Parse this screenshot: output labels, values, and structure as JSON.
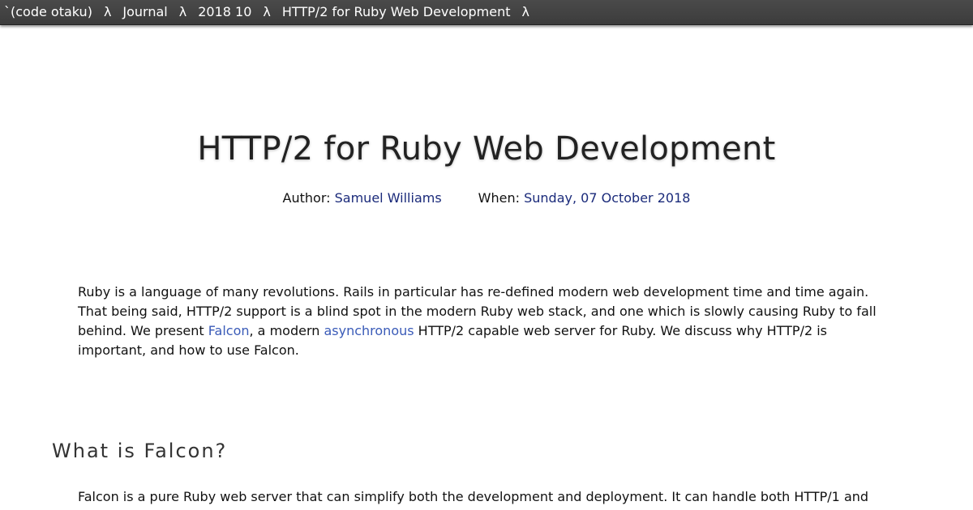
{
  "nav": {
    "breadcrumbs": [
      "`(code otaku)",
      "Journal",
      "2018 10",
      "HTTP/2 for Ruby Web Development"
    ],
    "separator": "λ"
  },
  "article": {
    "title": "HTTP/2 for Ruby Web Development",
    "author_label": "Author:",
    "author": "Samuel Williams",
    "date_label": "When:",
    "date": "Sunday, 07 October 2018",
    "intro": {
      "part1": "Ruby is a language of many revolutions. Rails in particular has re-defined modern web development time and time again. That being said, HTTP/2 support is a blind spot in the modern Ruby web stack, and one which is slowly causing Ruby to fall behind. We present ",
      "link1": "Falcon",
      "part2": ", a modern ",
      "link2": "asynchronous",
      "part3": " HTTP/2 capable web server for Ruby. We discuss why HTTP/2 is important, and how to use Falcon."
    },
    "section_heading": "What is Falcon?",
    "section_paragraph": "Falcon is a pure Ruby web server that can simplify both the development and deployment. It can handle both HTTP/1 and"
  },
  "colors": {
    "topbar": "#444444",
    "meta_value": "#1a2a7a",
    "link": "#3a5bb8"
  }
}
